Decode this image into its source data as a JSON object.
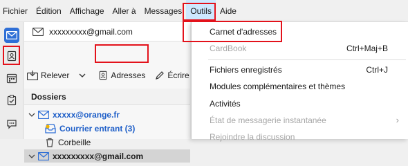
{
  "menubar": {
    "items": [
      {
        "label": "Fichier"
      },
      {
        "label": "Édition"
      },
      {
        "label": "Affichage"
      },
      {
        "label": "Aller à"
      },
      {
        "label": "Messages"
      },
      {
        "label": "Outils"
      },
      {
        "label": "Aide"
      }
    ]
  },
  "account_header": {
    "address": "xxxxxxxxx@gmail.com"
  },
  "toolbar": {
    "get_mail_label": "Relever",
    "address_book_label": "Adresses",
    "write_label": "Écrire"
  },
  "folders": {
    "header": "Dossiers",
    "orange_account": "xxxxx@orange.fr",
    "inbox": "Courrier entrant (3)",
    "trash": "Corbeille",
    "gmail_account": "xxxxxxxxx@gmail.com"
  },
  "tools_menu": {
    "address_book": "Carnet d'adresses",
    "cardbook": "CardBook",
    "cardbook_shortcut": "Ctrl+Maj+B",
    "saved_files": "Fichiers enregistrés",
    "saved_files_shortcut": "Ctrl+J",
    "addons": "Modules complémentaires et thèmes",
    "activities": "Activités",
    "im_status": "État de messagerie instantanée",
    "join_chat": "Rejoindre la discussion"
  },
  "colors": {
    "highlight_red": "#e3121b",
    "accent_blue": "#2f6fd6",
    "link_blue": "#1f5fc8"
  }
}
